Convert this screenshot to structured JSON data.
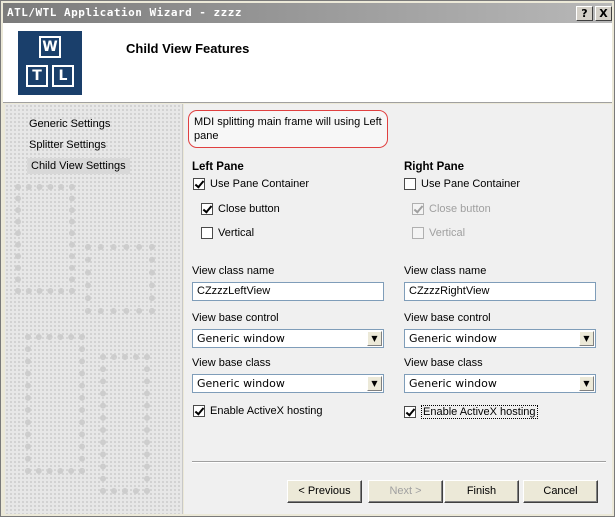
{
  "window": {
    "title": "ATL/WTL Application Wizard - zzzz",
    "help_label": "?",
    "close_label": "X"
  },
  "header": {
    "title": "Child View Features",
    "logo_letters": [
      "W",
      "T",
      "L"
    ]
  },
  "nav": {
    "items": [
      {
        "label": "Generic Settings",
        "active": false
      },
      {
        "label": "Splitter Settings",
        "active": false
      },
      {
        "label": "Child View Settings",
        "active": true
      }
    ]
  },
  "info": {
    "text": "MDI splitting main frame will using Left pane"
  },
  "left_pane": {
    "heading": "Left Pane",
    "use_pane_container": {
      "label": "Use Pane Container",
      "checked": true
    },
    "close_button": {
      "label": "Close button",
      "checked": true
    },
    "vertical": {
      "label": "Vertical",
      "checked": false
    },
    "view_class_name_label": "View class name",
    "view_class_name_value": "CZzzzLeftView",
    "view_base_control_label": "View base control",
    "view_base_control_value": "Generic window",
    "view_base_class_label": "View base class",
    "view_base_class_value": "Generic window",
    "activex": {
      "label": "Enable ActiveX hosting",
      "checked": true
    }
  },
  "right_pane": {
    "heading": "Right Pane",
    "use_pane_container": {
      "label": "Use Pane Container",
      "checked": false
    },
    "close_button": {
      "label": "Close button",
      "checked": true,
      "disabled": true
    },
    "vertical": {
      "label": "Vertical",
      "checked": false,
      "disabled": true
    },
    "view_class_name_label": "View class name",
    "view_class_name_value": "CZzzzRightView",
    "view_base_control_label": "View base control",
    "view_base_control_value": "Generic window",
    "view_base_class_label": "View base class",
    "view_base_class_value": "Generic window",
    "activex": {
      "label": "Enable ActiveX hosting",
      "checked": true
    }
  },
  "buttons": {
    "previous": "< Previous",
    "next": "Next >",
    "finish": "Finish",
    "cancel": "Cancel"
  },
  "icons": {
    "dropdown": "chevron-down-icon",
    "check": "checkmark-icon"
  }
}
